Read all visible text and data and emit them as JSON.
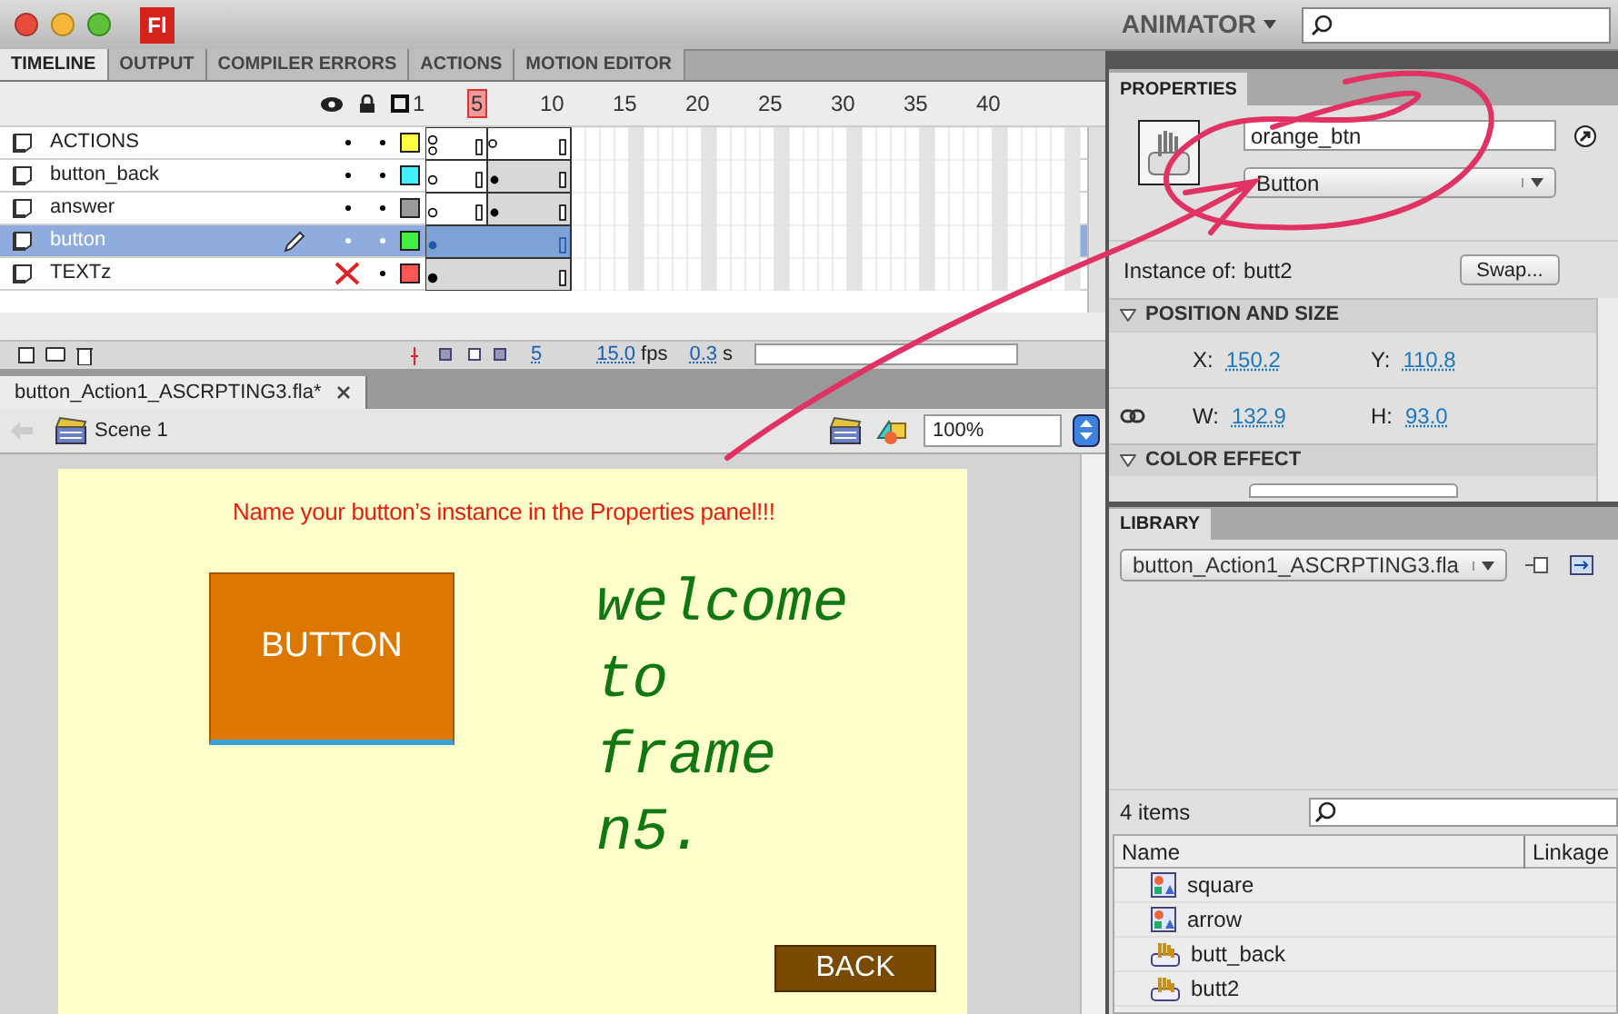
{
  "app": {
    "logo": "Fl",
    "workspace": "ANIMATOR"
  },
  "panel_tabs": [
    {
      "label": "TIMELINE",
      "selected": true
    },
    {
      "label": "OUTPUT",
      "selected": false
    },
    {
      "label": "COMPILER ERRORS",
      "selected": false
    },
    {
      "label": "ACTIONS",
      "selected": false
    },
    {
      "label": "MOTION EDITOR",
      "selected": false
    }
  ],
  "timeline": {
    "frame_numbers": [
      "1",
      "5",
      "10",
      "15",
      "20",
      "25",
      "30",
      "35",
      "40"
    ],
    "layers": [
      {
        "name": "ACTIONS",
        "selected": false,
        "visible": true,
        "editing": false,
        "color": "#ffff44"
      },
      {
        "name": "button_back",
        "selected": false,
        "visible": true,
        "editing": false,
        "color": "#44eeff"
      },
      {
        "name": "answer",
        "selected": false,
        "visible": true,
        "editing": false,
        "color": "#999999"
      },
      {
        "name": "button",
        "selected": true,
        "visible": true,
        "editing": true,
        "color": "#44ee44"
      },
      {
        "name": "TEXTz",
        "selected": false,
        "visible": false,
        "editing": false,
        "color": "#ff5555"
      }
    ],
    "current_frame": "5",
    "fps": "15.0",
    "fps_unit": "fps",
    "time": "0.3",
    "time_unit": "s"
  },
  "document": {
    "tab": "button_Action1_ASCRPTING3.fla*",
    "scene": "Scene 1",
    "zoom": "100%"
  },
  "stage": {
    "instruction": "Name your button’s instance in the Properties panel!!!",
    "button_label": "BUTTON",
    "message_lines": [
      "welcome",
      "to",
      "frame",
      "n5."
    ],
    "back_label": "BACK"
  },
  "properties": {
    "tab": "PROPERTIES",
    "instance_name": "orange_btn",
    "symbol_type": "Button",
    "instance_of_label": "Instance of:",
    "instance_of": "butt2",
    "swap": "Swap...",
    "sections": [
      {
        "title": "POSITION AND SIZE",
        "expanded": true,
        "rows": [
          [
            {
              "label": "X:",
              "value": "150.2"
            },
            {
              "label": "Y:",
              "value": "110.8"
            }
          ],
          [
            {
              "label": "W:",
              "value": "132.9"
            },
            {
              "label": "H:",
              "value": "93.0"
            }
          ]
        ]
      },
      {
        "title": "COLOR EFFECT",
        "expanded": true
      }
    ]
  },
  "library": {
    "tab": "LIBRARY",
    "file": "button_Action1_ASCRPTING3.fla",
    "count": "4 items",
    "columns": [
      "Name",
      "Linkage"
    ],
    "items": [
      {
        "name": "square",
        "kind": "graphic"
      },
      {
        "name": "arrow",
        "kind": "graphic"
      },
      {
        "name": "butt_back",
        "kind": "button"
      },
      {
        "name": "butt2",
        "kind": "button"
      }
    ]
  }
}
